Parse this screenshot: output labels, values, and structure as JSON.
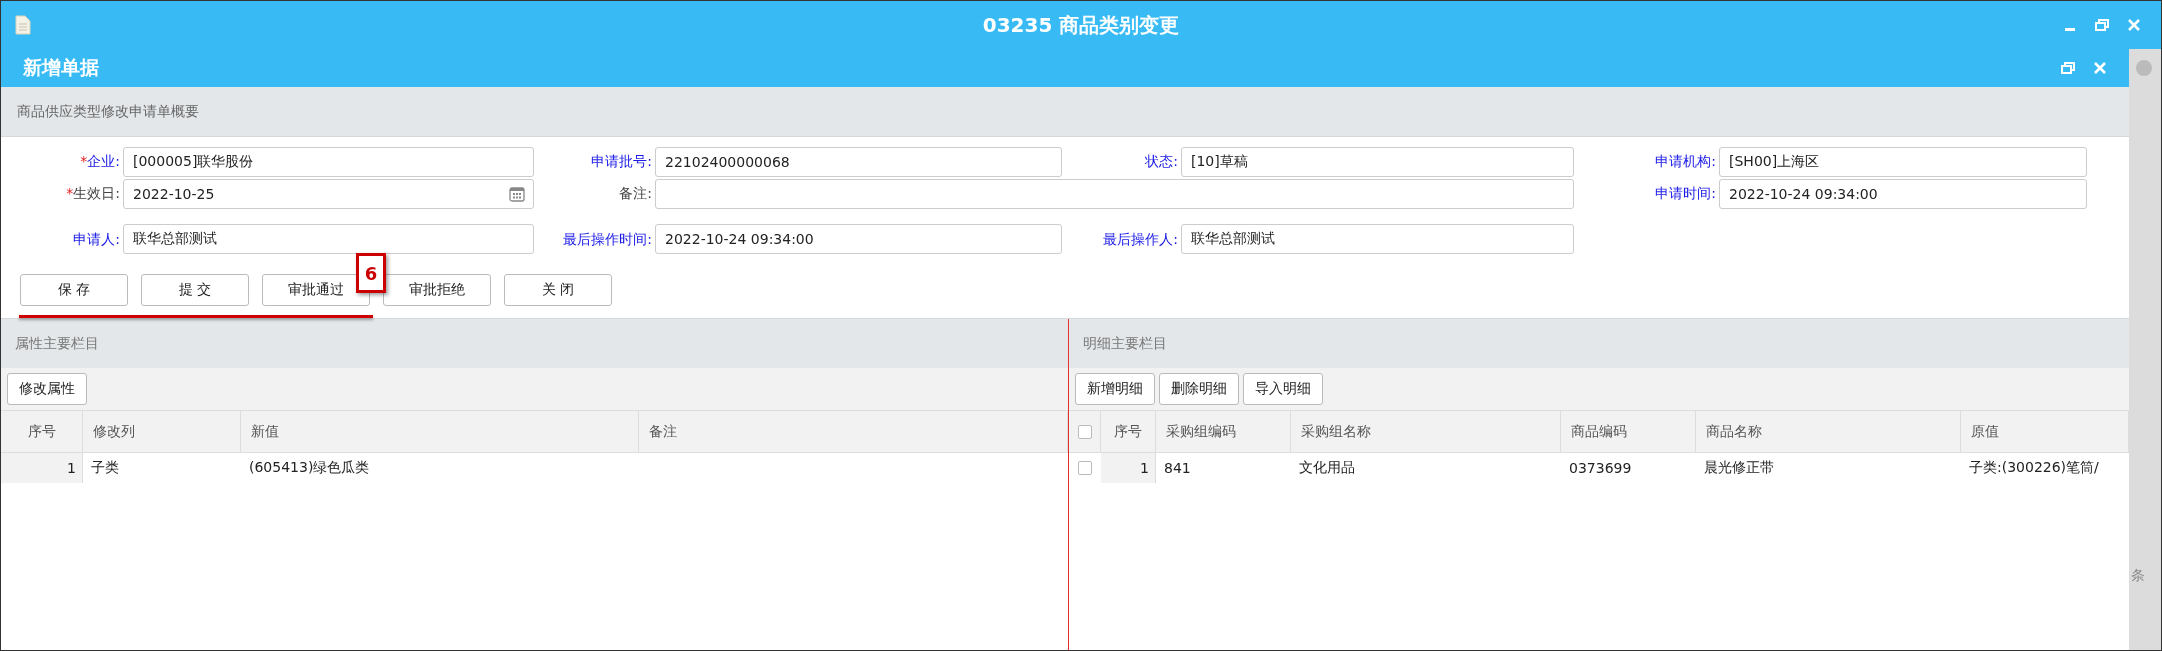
{
  "window": {
    "title": "03235 商品类别变更"
  },
  "dialog": {
    "title": "新增单据"
  },
  "summary_section": {
    "title": "商品供应类型修改申请单概要"
  },
  "form_rows": [
    [
      {
        "label": "企业:",
        "required_mark": "*",
        "highlighted": true,
        "kind": "text",
        "value": "[000005]联华股份"
      },
      {
        "label": "申请批号:",
        "highlighted": true,
        "kind": "text",
        "value": "22102400000068"
      },
      {
        "label": "状态:",
        "highlighted": true,
        "kind": "text",
        "value": "[10]草稿"
      },
      {
        "label": "申请机构:",
        "highlighted": true,
        "kind": "text",
        "value": "[SH00]上海区"
      }
    ],
    [
      {
        "label": "生效日:",
        "required_mark": "*",
        "highlighted": false,
        "kind": "date",
        "value": "2022-10-25"
      },
      {
        "label": "备注:",
        "highlighted": false,
        "kind": "wide"
      },
      {
        "label": "申请时间:",
        "highlighted": true,
        "kind": "text",
        "value": "2022-10-24 09:34:00"
      }
    ],
    [
      {
        "label": "申请人:",
        "highlighted": true,
        "kind": "text",
        "value": "联华总部测试"
      },
      {
        "label": "最后操作时间:",
        "highlighted": true,
        "kind": "text",
        "value": "2022-10-24 09:34:00"
      },
      {
        "label": "最后操作人:",
        "highlighted": true,
        "kind": "text",
        "value": "联华总部测试"
      }
    ]
  ],
  "buttons": [
    "保 存",
    "提 交",
    "审批通过",
    "审批拒绝",
    "关 闭"
  ],
  "annotation": {
    "label": "6"
  },
  "left_panel": {
    "title": "属性主要栏目",
    "toolbar_buttons": [
      "修改属性"
    ],
    "table": {
      "columns": [
        "序号",
        "修改列",
        "新值",
        "备注"
      ],
      "rows": [
        {
          "cells": [
            "1",
            "子类",
            "(605413)绿色瓜类"
          ]
        }
      ]
    }
  },
  "right_panel": {
    "title": "明细主要栏目",
    "toolbar_buttons": [
      "新增明细",
      "删除明细",
      "导入明细"
    ],
    "table": {
      "header_checked": false,
      "columns": [
        "序号",
        "采购组编码",
        "采购组名称",
        "商品编码",
        "商品名称",
        "原值"
      ],
      "rows": [
        {
          "checked": false,
          "cells": [
            "1",
            "841",
            "文化用品",
            "0373699",
            "晨光修正带",
            "子类:(300226)笔筒/"
          ]
        }
      ]
    }
  },
  "side_strip": {
    "text": "条"
  }
}
